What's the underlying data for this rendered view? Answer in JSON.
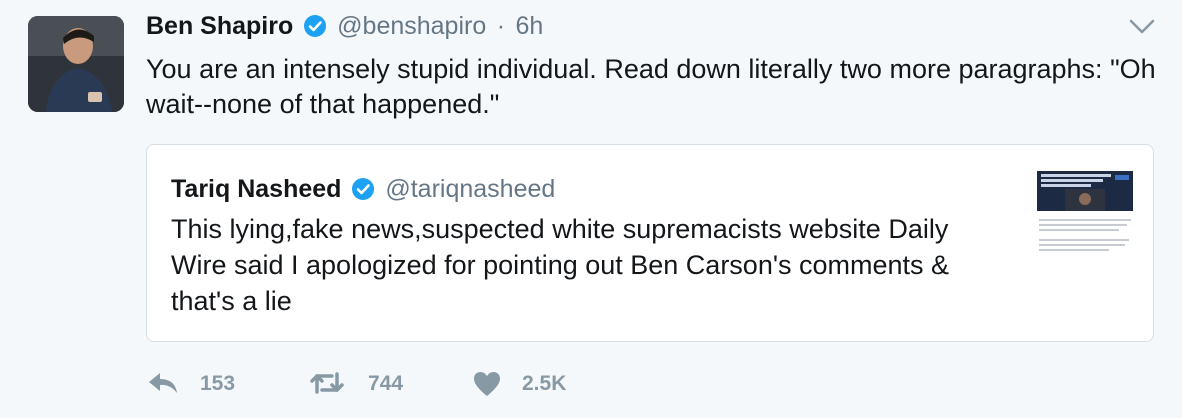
{
  "tweet": {
    "author_name": "Ben Shapiro",
    "handle": "@benshapiro",
    "separator": "·",
    "time": "6h",
    "text": "You are an intensely stupid individual. Read down literally two more paragraphs: \"Oh wait--none of that happened.\"",
    "verified_icon": "verified-badge",
    "menu_icon": "chevron-down-icon"
  },
  "quoted": {
    "author_name": "Tariq Nasheed",
    "handle": "@tariqnasheed",
    "text": "This lying,fake news,suspected white supremacists website Daily Wire said I apologized for pointing out Ben Carson's comments & that's a lie",
    "verified_icon": "verified-badge"
  },
  "actions": {
    "reply": {
      "icon": "reply-icon",
      "count": "153"
    },
    "retweet": {
      "icon": "retweet-icon",
      "count": "744"
    },
    "like": {
      "icon": "heart-icon",
      "count": "2.5K"
    }
  },
  "colors": {
    "background": "#f5f8fa",
    "verified": "#1da1f2",
    "muted": "#657786",
    "action": "#8899a6"
  }
}
